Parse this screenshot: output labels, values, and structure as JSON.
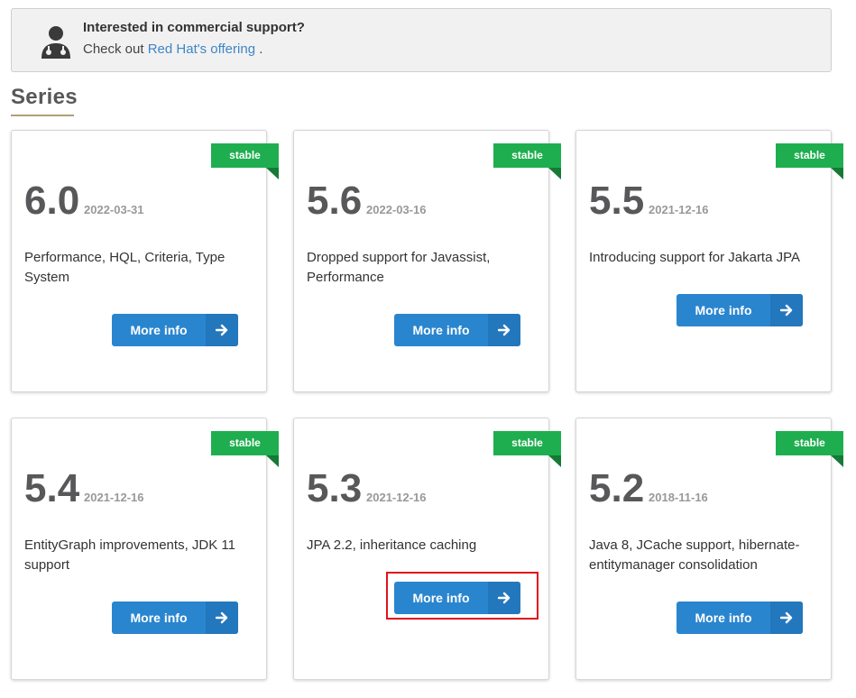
{
  "banner": {
    "title": "Interested in commercial support?",
    "prefix": "Check out",
    "link": "Red Hat's offering",
    "suffix": " ."
  },
  "section_title": "Series",
  "colors": {
    "ribbon": "#1fae4f",
    "button": "#2a85cf",
    "link": "#3f86c6",
    "highlight": "#e0131b"
  },
  "cards": [
    {
      "badge": "stable",
      "version": "6.0",
      "date": "2022-03-31",
      "description": "Performance, HQL, Criteria, Type System",
      "button": "More info"
    },
    {
      "badge": "stable",
      "version": "5.6",
      "date": "2022-03-16",
      "description": "Dropped support for Javassist, Performance",
      "button": "More info"
    },
    {
      "badge": "stable",
      "version": "5.5",
      "date": "2021-12-16",
      "description": "Introducing support for Jakarta JPA",
      "button": "More info"
    },
    {
      "badge": "stable",
      "version": "5.4",
      "date": "2021-12-16",
      "description": "EntityGraph improvements, JDK 11 support",
      "button": "More info"
    },
    {
      "badge": "stable",
      "version": "5.3",
      "date": "2021-12-16",
      "description": "JPA 2.2, inheritance caching",
      "button": "More info"
    },
    {
      "badge": "stable",
      "version": "5.2",
      "date": "2018-11-16",
      "description": "Java 8, JCache support, hibernate-entitymanager consolidation",
      "button": "More info"
    }
  ]
}
